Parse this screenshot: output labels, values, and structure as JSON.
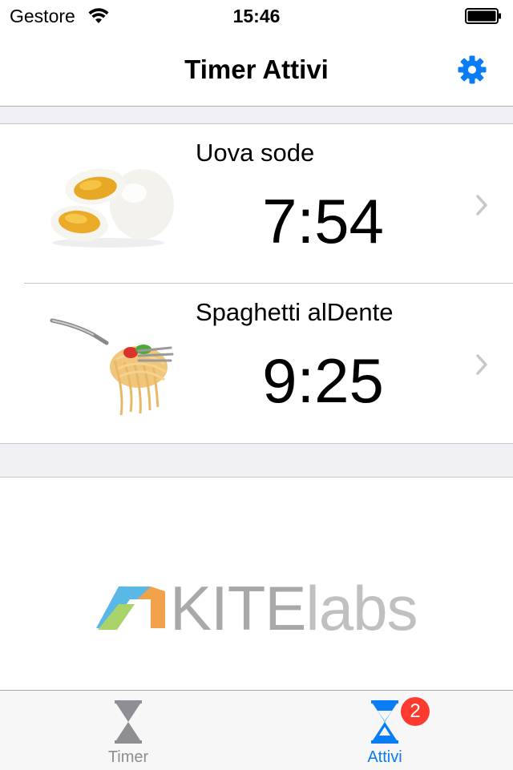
{
  "status_bar": {
    "carrier": "Gestore",
    "time": "15:46",
    "battery_level": 1.0
  },
  "nav": {
    "title": "Timer Attivi",
    "settings_icon": "gear-icon"
  },
  "accent_color": "#0a7cf5",
  "timers": [
    {
      "name": "Uova sode",
      "time": "7:54",
      "image": "boiled-eggs-image"
    },
    {
      "name": "Spaghetti alDente",
      "time": "9:25",
      "image": "spaghetti-fork-image"
    }
  ],
  "logo": {
    "kite": "KITE",
    "labs": "labs"
  },
  "tabs": [
    {
      "label": "Timer",
      "icon": "hourglass-icon",
      "selected": false
    },
    {
      "label": "Attivi",
      "icon": "hourglass-icon",
      "selected": true,
      "badge": "2"
    }
  ]
}
